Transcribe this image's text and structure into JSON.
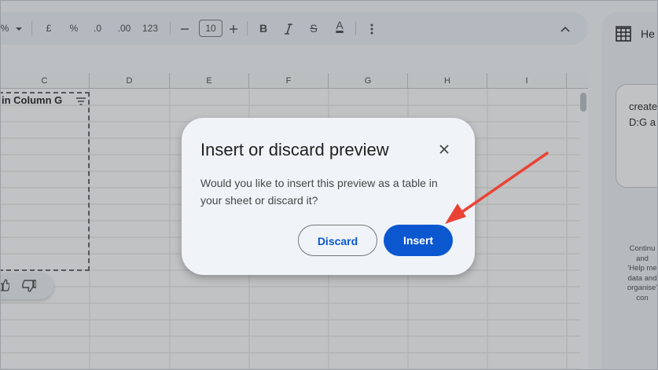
{
  "toolbar": {
    "percent_partial": "%",
    "currency": "£",
    "percent": "%",
    "dec_decrease": ".0",
    "dec_increase": ".00",
    "number_format": "123",
    "font_size": "10",
    "bold": "B",
    "strikethrough": "S",
    "text_color": "A"
  },
  "grid": {
    "columns": [
      "C",
      "D",
      "E",
      "F",
      "G",
      "H",
      "I"
    ],
    "preview_header": "in Column G"
  },
  "side_panel": {
    "title": "He",
    "prompt_text": "create\nD:G a",
    "info_text": "Continu\nand\n'Help me\ndata and\norganise'\ncon"
  },
  "dialog": {
    "title": "Insert or discard preview",
    "body": "Would you like to insert this preview as a table in your sheet or discard it?",
    "discard_label": "Discard",
    "insert_label": "Insert"
  },
  "colors": {
    "primary": "#0b57d0",
    "annotation_arrow": "#ea4335",
    "dialog_bg": "#f0f4f9"
  }
}
